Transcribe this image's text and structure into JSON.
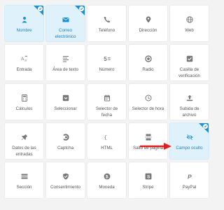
{
  "colors": {
    "accent": "#1a8fd6",
    "selected_bg": "#dff1fb",
    "icon_gray": "#777777",
    "arrow_red": "#e02020"
  },
  "fields": [
    {
      "label": "Nombre",
      "icon": "person-icon",
      "selected": true
    },
    {
      "label": "Correo electrónico",
      "icon": "envelope-icon",
      "selected": true
    },
    {
      "label": "Teléfono",
      "icon": "phone-icon",
      "selected": false
    },
    {
      "label": "Dirección",
      "icon": "map-pin-icon",
      "selected": false
    },
    {
      "label": "Web",
      "icon": "globe-icon",
      "selected": false
    },
    {
      "label": "Entrada",
      "icon": "text-input-icon",
      "selected": false
    },
    {
      "label": "Área de texto",
      "icon": "textarea-icon",
      "selected": false
    },
    {
      "label": "Número",
      "icon": "number-icon",
      "selected": false
    },
    {
      "label": "Radio",
      "icon": "radio-icon",
      "selected": false
    },
    {
      "label": "Casilla de verificación",
      "icon": "checkbox-icon",
      "selected": false
    },
    {
      "label": "Cálculos",
      "icon": "calculator-icon",
      "selected": false
    },
    {
      "label": "Seleccionar",
      "icon": "select-icon",
      "selected": false
    },
    {
      "label": "Selector de fecha",
      "icon": "calendar-icon",
      "selected": false
    },
    {
      "label": "Selector de hora",
      "icon": "clock-icon",
      "selected": false
    },
    {
      "label": "Subida de archivo",
      "icon": "upload-icon",
      "selected": false
    },
    {
      "label": "Datos de las entradas",
      "icon": "pin-icon",
      "selected": false
    },
    {
      "label": "Captcha",
      "icon": "captcha-icon",
      "selected": false
    },
    {
      "label": "HTML",
      "icon": "code-braces-icon",
      "selected": false
    },
    {
      "label": "Salto de página",
      "icon": "page-break-icon",
      "selected": false
    },
    {
      "label": "Campo oculto",
      "icon": "eye-slash-icon",
      "selected": true
    },
    {
      "label": "Sección",
      "icon": "section-icon",
      "selected": false
    },
    {
      "label": "Consentimiento",
      "icon": "shield-check-icon",
      "selected": false
    },
    {
      "label": "Moneda",
      "icon": "currency-icon",
      "selected": false
    },
    {
      "label": "Stripe",
      "icon": "stripe-icon",
      "selected": false
    },
    {
      "label": "PayPal",
      "icon": "paypal-icon",
      "selected": false
    }
  ]
}
